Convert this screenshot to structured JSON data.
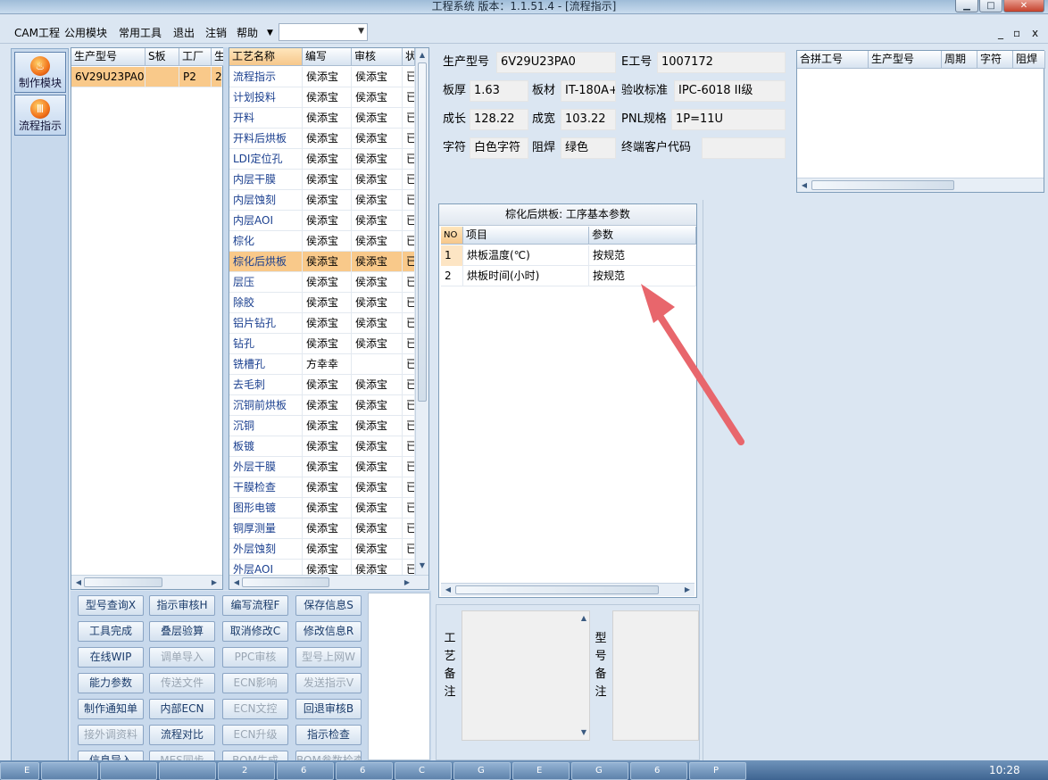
{
  "window": {
    "title": "工程系统  版本：1.1.51.4 - [流程指示]",
    "min_icon": "minimize-icon",
    "max_icon": "maximize-icon",
    "close_icon": "close-icon"
  },
  "menu": {
    "items": [
      "CAM工程",
      "公用模块",
      "常用工具",
      "退出",
      "注销",
      "帮助"
    ],
    "combo_value": "",
    "mdi": [
      "_",
      "▫",
      "x"
    ]
  },
  "nav": [
    {
      "label": "制作模块",
      "icon": "flame-icon"
    },
    {
      "label": "流程指示",
      "icon": "flow-icon"
    }
  ],
  "models": {
    "headers": [
      "生产型号",
      "S板",
      "工厂",
      "生"
    ],
    "rows": [
      [
        "6V29U23PA0",
        "",
        "P2",
        "2"
      ]
    ]
  },
  "process": {
    "headers": [
      "工艺名称",
      "编写",
      "审核",
      "状"
    ],
    "selected_index": 9,
    "rows": [
      [
        "流程指示",
        "侯添宝",
        "侯添宝",
        "已"
      ],
      [
        "计划投料",
        "侯添宝",
        "侯添宝",
        "已"
      ],
      [
        "开料",
        "侯添宝",
        "侯添宝",
        "已"
      ],
      [
        "开料后烘板",
        "侯添宝",
        "侯添宝",
        "已"
      ],
      [
        "LDI定位孔",
        "侯添宝",
        "侯添宝",
        "已"
      ],
      [
        "内层干膜",
        "侯添宝",
        "侯添宝",
        "已"
      ],
      [
        "内层蚀刻",
        "侯添宝",
        "侯添宝",
        "已"
      ],
      [
        "内层AOI",
        "侯添宝",
        "侯添宝",
        "已"
      ],
      [
        "棕化",
        "侯添宝",
        "侯添宝",
        "已"
      ],
      [
        "棕化后烘板",
        "侯添宝",
        "侯添宝",
        "已"
      ],
      [
        "层压",
        "侯添宝",
        "侯添宝",
        "已"
      ],
      [
        "除胶",
        "侯添宝",
        "侯添宝",
        "已"
      ],
      [
        "铝片钻孔",
        "侯添宝",
        "侯添宝",
        "已"
      ],
      [
        "钻孔",
        "侯添宝",
        "侯添宝",
        "已"
      ],
      [
        "铣槽孔",
        "方幸幸",
        "",
        "已"
      ],
      [
        "去毛刺",
        "侯添宝",
        "侯添宝",
        "已"
      ],
      [
        "沉铜前烘板",
        "侯添宝",
        "侯添宝",
        "已"
      ],
      [
        "沉铜",
        "侯添宝",
        "侯添宝",
        "已"
      ],
      [
        "板镀",
        "侯添宝",
        "侯添宝",
        "已"
      ],
      [
        "外层干膜",
        "侯添宝",
        "侯添宝",
        "已"
      ],
      [
        "干膜检查",
        "侯添宝",
        "侯添宝",
        "已"
      ],
      [
        "图形电镀",
        "侯添宝",
        "侯添宝",
        "已"
      ],
      [
        "铜厚测量",
        "侯添宝",
        "侯添宝",
        "已"
      ],
      [
        "外层蚀刻",
        "侯添宝",
        "侯添宝",
        "已"
      ],
      [
        "外层AOI",
        "侯添宝",
        "侯添宝",
        "已"
      ]
    ]
  },
  "actions": [
    [
      "型号查询X",
      "指示审核H",
      "编写流程F",
      "保存信息S"
    ],
    [
      "工具完成",
      "叠层验算",
      "取消修改C",
      "修改信息R"
    ],
    [
      "在线WIP",
      "调单导入",
      "PPC审核",
      "型号上网W"
    ],
    [
      "能力参数",
      "传送文件",
      "ECN影响",
      "发送指示V"
    ],
    [
      "制作通知单",
      "内部ECN",
      "ECN文控",
      "回退审核B"
    ],
    [
      "接外调资料",
      "流程对比",
      "ECN升级",
      "指示检查"
    ],
    [
      "信息导入",
      "MES同步",
      "BOM生成",
      "BOM参数检查"
    ]
  ],
  "actions_disabled": [
    "调单导入",
    "PPC审核",
    "型号上网W",
    "传送文件",
    "ECN影响",
    "发送指示V",
    "ECN文控",
    "接外调资料",
    "ECN升级",
    "MES同步",
    "BOM生成",
    "BOM参数检查"
  ],
  "info": {
    "model_label": "生产型号",
    "model": "6V29U23PA0",
    "e_label": "E工号",
    "e_no": "1007172",
    "thickness_label": "板厚",
    "thickness": "1.63",
    "material_label": "板材",
    "material": "IT-180A+",
    "standard_label": "验收标准",
    "standard": "IPC-6018 II级",
    "length_label": "成长",
    "length": "128.22",
    "width_label": "成宽",
    "width": "103.22",
    "pnl_label": "PNL规格",
    "pnl": "1P=11U",
    "char_label": "字符",
    "char": "白色字符",
    "mask_label": "阻焊",
    "mask": "绿色",
    "customer_label": "终端客户代码",
    "customer": ""
  },
  "merge": {
    "headers": [
      "合拼工号",
      "生产型号",
      "周期",
      "字符",
      "阻焊"
    ]
  },
  "params": {
    "title": "棕化后烘板: 工序基本参数",
    "headers": [
      "NO",
      "项目",
      "参数"
    ],
    "rows": [
      [
        "1",
        "烘板温度(℃)",
        "按规范"
      ],
      [
        "2",
        "烘板时间(小时)",
        "按规范"
      ]
    ]
  },
  "notes": {
    "process_label": "工艺备注",
    "model_label": "型号备注",
    "process_text": "",
    "model_text": ""
  },
  "annotation": {
    "color": "#e8666c"
  },
  "taskbar": {
    "clock": "10:28",
    "items": [
      "E",
      "",
      "",
      "",
      "2",
      "6",
      "6",
      "C",
      "G",
      "E",
      "G",
      "6",
      "P"
    ]
  }
}
